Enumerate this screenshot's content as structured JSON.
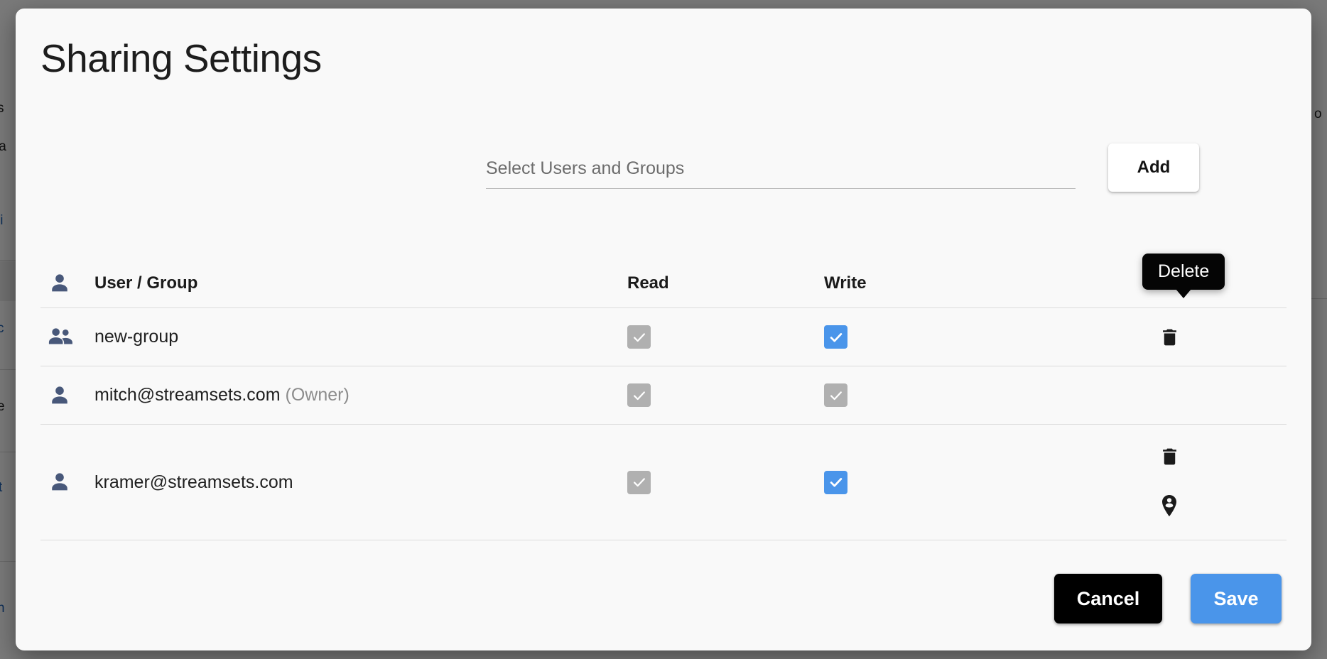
{
  "modal": {
    "title": "Sharing Settings"
  },
  "share_input": {
    "placeholder": "Select Users and Groups",
    "value": "",
    "add_label": "Add"
  },
  "table": {
    "headers": {
      "user_group": "User / Group",
      "read": "Read",
      "write": "Write"
    },
    "header_icon": "person-icon",
    "rows": [
      {
        "name": "new-group",
        "suffix": "",
        "icon": "group-icon",
        "read": {
          "checked": true,
          "state": "disabled",
          "color": "#b0b0b0"
        },
        "write": {
          "checked": true,
          "state": "enabled",
          "color": "#4a95ea"
        },
        "actions": [
          "delete-icon"
        ]
      },
      {
        "name": "mitch@streamsets.com",
        "suffix": "(Owner)",
        "icon": "person-icon",
        "read": {
          "checked": true,
          "state": "disabled",
          "color": "#b0b0b0"
        },
        "write": {
          "checked": true,
          "state": "disabled",
          "color": "#b0b0b0"
        },
        "actions": []
      },
      {
        "name": "kramer@streamsets.com",
        "suffix": "",
        "icon": "person-icon",
        "read": {
          "checked": true,
          "state": "disabled",
          "color": "#b0b0b0"
        },
        "write": {
          "checked": true,
          "state": "enabled",
          "color": "#4a95ea"
        },
        "actions": [
          "delete-icon",
          "person-pin-icon"
        ]
      }
    ]
  },
  "tooltip": {
    "text": "Delete"
  },
  "footer": {
    "cancel_label": "Cancel",
    "save_label": "Save"
  },
  "colors": {
    "accent_blue": "#4a95ea",
    "disabled_gray": "#b0b0b0",
    "cancel_black": "#000000",
    "person_icon": "#48587a",
    "modal_bg": "#f9f9f9"
  },
  "background_page": {
    "fragments": [
      "s",
      "la",
      "li",
      "c",
      "e",
      "t",
      "n",
      "o"
    ]
  }
}
